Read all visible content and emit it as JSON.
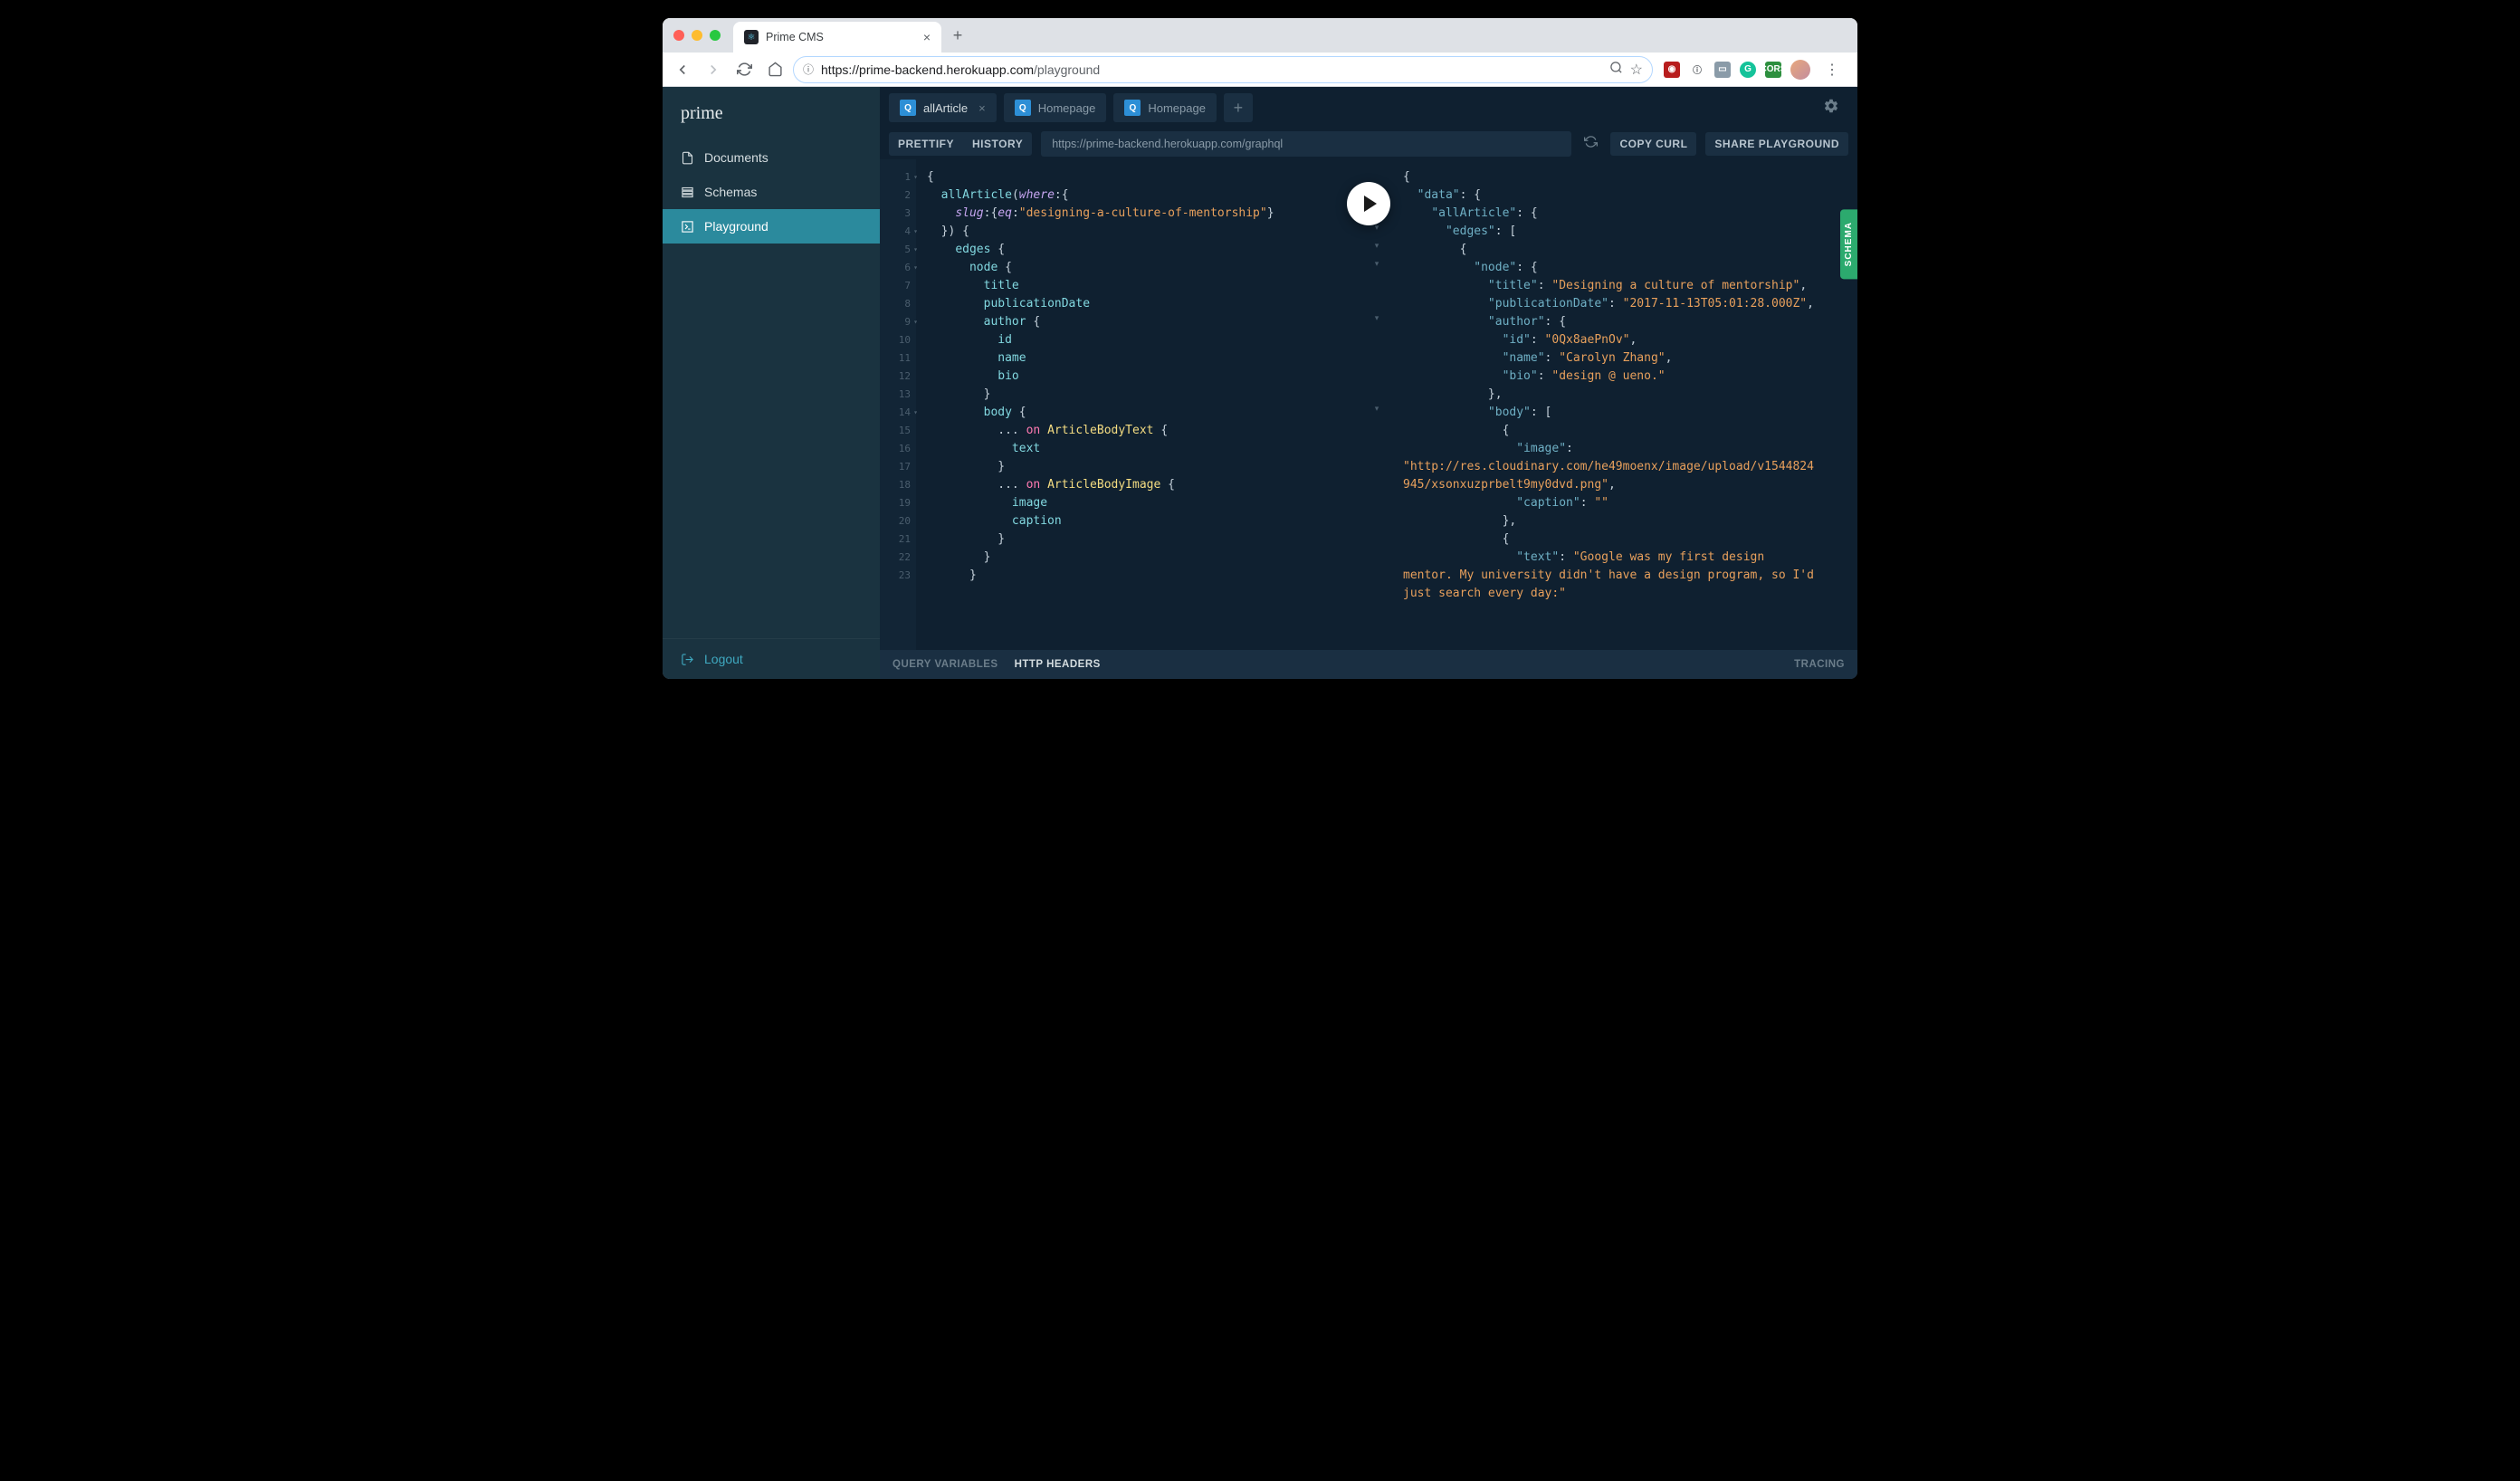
{
  "browser": {
    "tab_title": "Prime CMS",
    "url_host": "https://prime-backend.herokuapp.com",
    "url_path": "/playground"
  },
  "sidebar": {
    "logo": "prime",
    "items": [
      {
        "label": "Documents"
      },
      {
        "label": "Schemas"
      },
      {
        "label": "Playground"
      }
    ],
    "logout": "Logout"
  },
  "playground": {
    "tabs": [
      {
        "label": "allArticle",
        "active": true
      },
      {
        "label": "Homepage",
        "active": false
      },
      {
        "label": "Homepage",
        "active": false
      }
    ],
    "toolbar": {
      "prettify": "PRETTIFY",
      "history": "HISTORY",
      "endpoint": "https://prime-backend.herokuapp.com/graphql",
      "copy_curl": "COPY CURL",
      "share": "SHARE PLAYGROUND"
    },
    "schema_tab": "SCHEMA",
    "bottom": {
      "query_variables": "QUERY VARIABLES",
      "http_headers": "HTTP HEADERS",
      "tracing": "TRACING"
    },
    "query_lines": [
      "{",
      "  allArticle(where:{",
      "    slug:{eq:\"designing-a-culture-of-mentorship\"}",
      "  }) {",
      "    edges {",
      "      node {",
      "        title",
      "        publicationDate",
      "        author {",
      "          id",
      "          name",
      "          bio",
      "        }",
      "        body {",
      "          ... on ArticleBodyText {",
      "            text",
      "          }",
      "          ... on ArticleBodyImage {",
      "            image",
      "            caption",
      "          }",
      "        }",
      "      }"
    ],
    "result": {
      "data": {
        "allArticle": {
          "edges": [
            {
              "node": {
                "title": "Designing a culture of mentorship",
                "publicationDate": "2017-11-13T05:01:28.000Z",
                "author": {
                  "id": "0Qx8aePnOv",
                  "name": "Carolyn Zhang",
                  "bio": "design @ ueno."
                },
                "body": [
                  {
                    "image": "http://res.cloudinary.com/he49moenx/image/upload/v1544824945/xsonxuzprbelt9my0dvd.png",
                    "caption": ""
                  },
                  {
                    "text": "Google was my first design mentor. My university didn't have a design program, so I'd just search every day:"
                  }
                ]
              }
            }
          ]
        }
      }
    }
  }
}
